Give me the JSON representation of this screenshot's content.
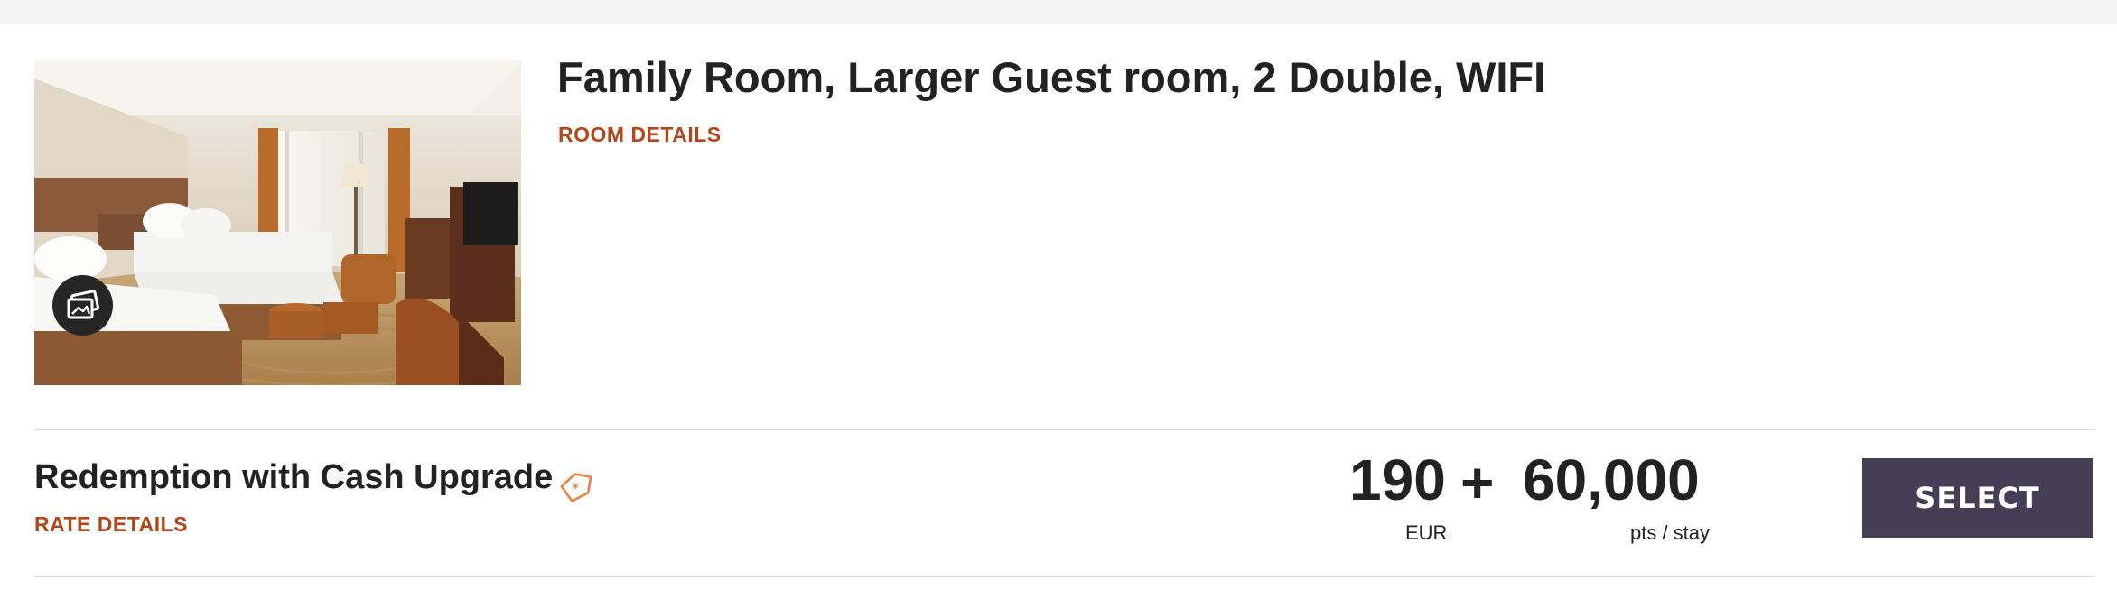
{
  "room": {
    "title": "Family Room, Larger Guest room, 2 Double, WIFI",
    "details_link": "ROOM DETAILS",
    "photo_alt": "Hotel room with two double beds",
    "gallery_icon": "photo-gallery-icon"
  },
  "rate": {
    "name": "Redemption with Cash Upgrade",
    "tag_icon": "price-tag-icon",
    "details_link": "RATE DETAILS",
    "cash_amount": "190",
    "plus_sign": "+",
    "cash_currency": "EUR",
    "points_amount": "60,000",
    "points_unit": "pts / stay",
    "select_label": "SELECT"
  },
  "colors": {
    "accent": "#b5451b",
    "button": "#443f55",
    "divider": "#dcdcdc",
    "top_strip": "#f4f4f4"
  }
}
